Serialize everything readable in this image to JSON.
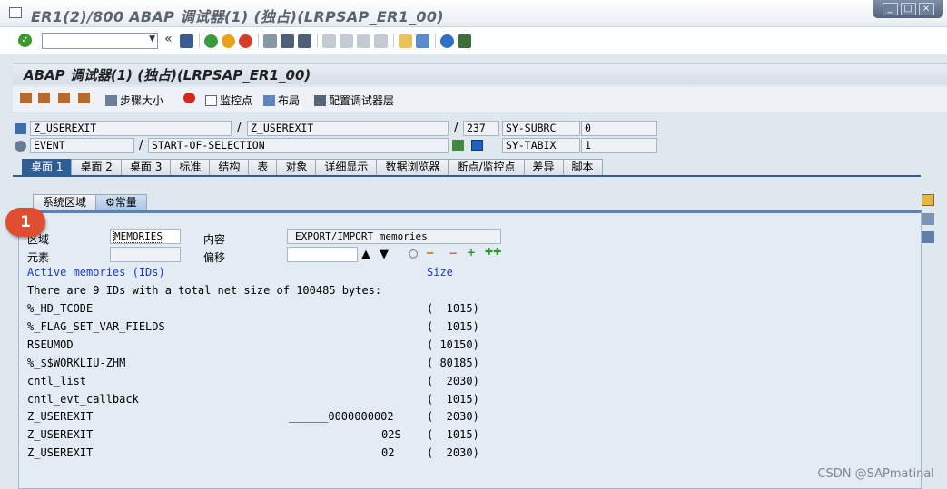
{
  "window": {
    "title": "ER1(2)/800 ABAP 调试器(1) (独占)(LRPSAP_ER1_00)",
    "controls": [
      "_",
      "□",
      "×"
    ]
  },
  "toolbar": {
    "command_value": "",
    "history_glyph": "«"
  },
  "screen": {
    "title": "ABAP 调试器(1) (独占)(LRPSAP_ER1_00)"
  },
  "app_toolbar": {
    "step_size": "步骤大小",
    "watchpoint": "监控点",
    "layout": "布局",
    "configure": "配置调试器层"
  },
  "info": {
    "program": "Z_USEREXIT",
    "include": "Z_USEREXIT",
    "line": "237",
    "sy1_name": "SY-SUBRC",
    "sy1_value": "0",
    "event_type": "EVENT",
    "event_name": "START-OF-SELECTION",
    "sy2_name": "SY-TABIX",
    "sy2_value": "1",
    "slash": "/"
  },
  "tabs": [
    "桌面 1",
    "桌面 2",
    "桌面 3",
    "标准",
    "结构",
    "表",
    "对象",
    "详细显示",
    "数据浏览器",
    "断点/监控点",
    "差异",
    "脚本"
  ],
  "subtabs": [
    "系统区域",
    "常量"
  ],
  "form": {
    "area_label": "区域",
    "area_value": "MEMORIES",
    "content_label": "内容",
    "content_value": "EXPORT/IMPORT memories",
    "element_label": "元素",
    "element_value": "",
    "offset_label": "偏移",
    "offset_value": ""
  },
  "list": {
    "header_left": "Active memories (IDs)",
    "header_right": "Size",
    "summary": "There are 9 IDs with a total net size of 100485 bytes:",
    "rows": [
      {
        "id": "%_HD_TCODE",
        "mid": "",
        "size": "(  1015)"
      },
      {
        "id": "%_FLAG_SET_VAR_FIELDS",
        "mid": "",
        "size": "(  1015)"
      },
      {
        "id": "RSEUMOD",
        "mid": "",
        "size": "( 10150)"
      },
      {
        "id": "%_$$WORKLIU-ZHM",
        "mid": "",
        "size": "( 80185)"
      },
      {
        "id": "cntl_list",
        "mid": "",
        "size": "(  2030)"
      },
      {
        "id": "cntl_evt_callback",
        "mid": "",
        "size": "(  1015)"
      },
      {
        "id": "Z_USEREXIT",
        "mid": "______0000000002",
        "size": "(  2030)"
      },
      {
        "id": "Z_USEREXIT",
        "mid": "02S",
        "size": "(  1015)"
      },
      {
        "id": "Z_USEREXIT",
        "mid": "02",
        "size": "(  2030)"
      }
    ]
  },
  "annotation": {
    "number": "1"
  },
  "watermark": "CSDN @SAPmatinal",
  "colors": {
    "accent": "#2f5e95",
    "list_header": "#1a3cc8",
    "badge": "#e04e32"
  }
}
